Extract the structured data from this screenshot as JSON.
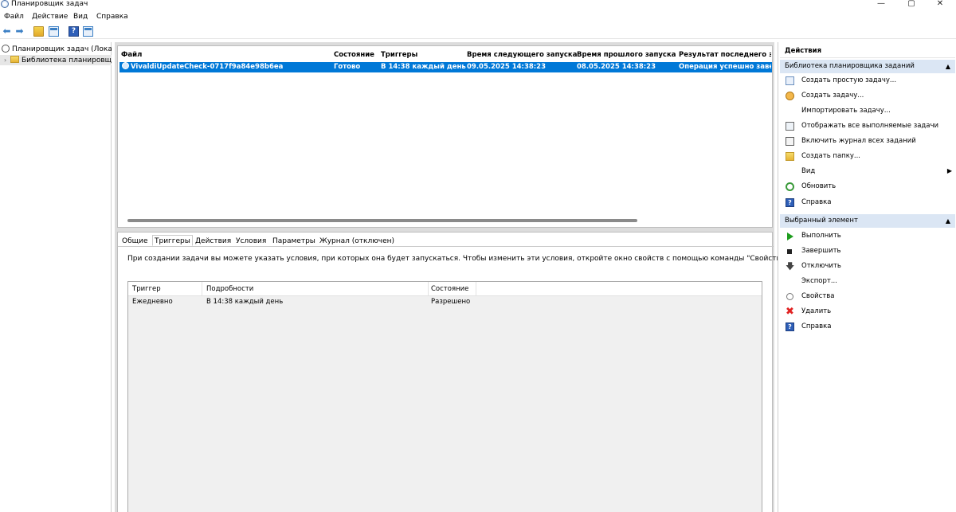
{
  "window": {
    "title": "Планировщик задач",
    "minimize": "—",
    "maximize": "▢",
    "close": "✕"
  },
  "menu": [
    "Файл",
    "Действие",
    "Вид",
    "Справка"
  ],
  "toolbar": {
    "back": "⬅",
    "forward": "➡",
    "help": "?"
  },
  "tree": {
    "root": "Планировщик задач (Локальный)",
    "library": "Библиотека планировщика заданий",
    "chevron": "›"
  },
  "task_list": {
    "columns": [
      "Файл",
      "Состояние",
      "Триггеры",
      "Время следующего запуска",
      "Время прошлого запуска",
      "Результат последнего запуска"
    ],
    "rows": [
      {
        "name": "VivaldiUpdateCheck-0717f9a84e98b6ea",
        "state": "Готово",
        "triggers": "В 14:38 каждый день",
        "next_run": "09.05.2025 14:38:23",
        "last_run": "08.05.2025 14:38:23",
        "last_result": "Операция успешно завершена."
      }
    ]
  },
  "details": {
    "tabs": [
      "Общие",
      "Триггеры",
      "Действия",
      "Условия",
      "Параметры",
      "Журнал (отключен)"
    ],
    "active_tab": "Триггеры",
    "info": "При создании задачи вы можете указать условия, при которых она будет запускаться.  Чтобы изменить эти условия, откройте окно свойств с помощью команды \"Свойства\".",
    "trigger_columns": [
      "Триггер",
      "Подробности",
      "Состояние"
    ],
    "trigger_rows": [
      {
        "trigger": "Ежедневно",
        "details": "В 14:38 каждый день",
        "state": "Разрешено"
      }
    ]
  },
  "actions": {
    "title": "Действия",
    "library_section": {
      "header": "Библиотека планировщика заданий",
      "caret": "▲",
      "items": [
        {
          "label": "Создать простую задачу...",
          "icon": "create-basic-task-icon"
        },
        {
          "label": "Создать задачу...",
          "icon": "create-task-icon"
        },
        {
          "label": "Импортировать задачу...",
          "icon": ""
        },
        {
          "label": "Отображать все выполняемые задачи",
          "icon": "running-tasks-icon"
        },
        {
          "label": "Включить журнал всех заданий",
          "icon": "history-log-icon"
        },
        {
          "label": "Создать папку...",
          "icon": "folder-icon"
        },
        {
          "label": "Вид",
          "icon": "",
          "submenu": "▶"
        },
        {
          "label": "Обновить",
          "icon": "refresh-icon"
        },
        {
          "label": "Справка",
          "icon": "help-icon"
        }
      ]
    },
    "selected_section": {
      "header": "Выбранный элемент",
      "caret": "▲",
      "items": [
        {
          "label": "Выполнить",
          "icon": "run-icon"
        },
        {
          "label": "Завершить",
          "icon": "stop-icon"
        },
        {
          "label": "Отключить",
          "icon": "disable-icon"
        },
        {
          "label": "Экспорт...",
          "icon": ""
        },
        {
          "label": "Свойства",
          "icon": "properties-icon"
        },
        {
          "label": "Удалить",
          "icon": "delete-icon"
        },
        {
          "label": "Справка",
          "icon": "help-icon"
        }
      ]
    },
    "help_glyph": "?",
    "disable_glyph": "🡇",
    "delete_glyph": "✖"
  }
}
